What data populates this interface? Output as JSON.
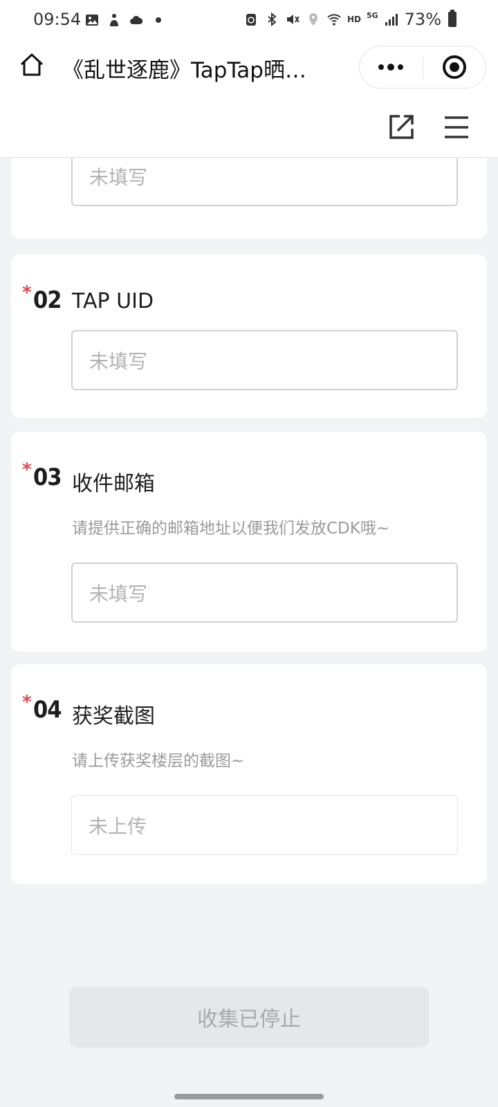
{
  "status_bar": {
    "time": "09:54",
    "network": "HD",
    "signal": "5G",
    "battery": "73%",
    "icons": [
      "image-icon",
      "person-icon",
      "cloud-icon",
      "dot-icon",
      "recycle-icon",
      "bluetooth-icon",
      "mute-icon",
      "location-icon",
      "wifi-icon",
      "signal-icon",
      "battery-icon"
    ]
  },
  "titlebar": {
    "title": "《乱世逐鹿》TapTap晒…",
    "home_icon": "home-icon",
    "more_icon": "more-dots-icon",
    "close_icon": "target-icon"
  },
  "toolbar": {
    "share_icon": "share-icon",
    "menu_icon": "menu-icon"
  },
  "form": {
    "q1": {
      "placeholder": "未填写"
    },
    "q2": {
      "required": "*",
      "number": "02",
      "title": "TAP UID",
      "placeholder": "未填写"
    },
    "q3": {
      "required": "*",
      "number": "03",
      "title": "收件邮箱",
      "desc": "请提供正确的邮箱地址以便我们发放CDK哦~",
      "placeholder": "未填写"
    },
    "q4": {
      "required": "*",
      "number": "04",
      "title": "获奖截图",
      "desc": "请上传获奖楼层的截图~",
      "placeholder": "未上传"
    }
  },
  "footer": {
    "submit_label": "收集已停止"
  }
}
